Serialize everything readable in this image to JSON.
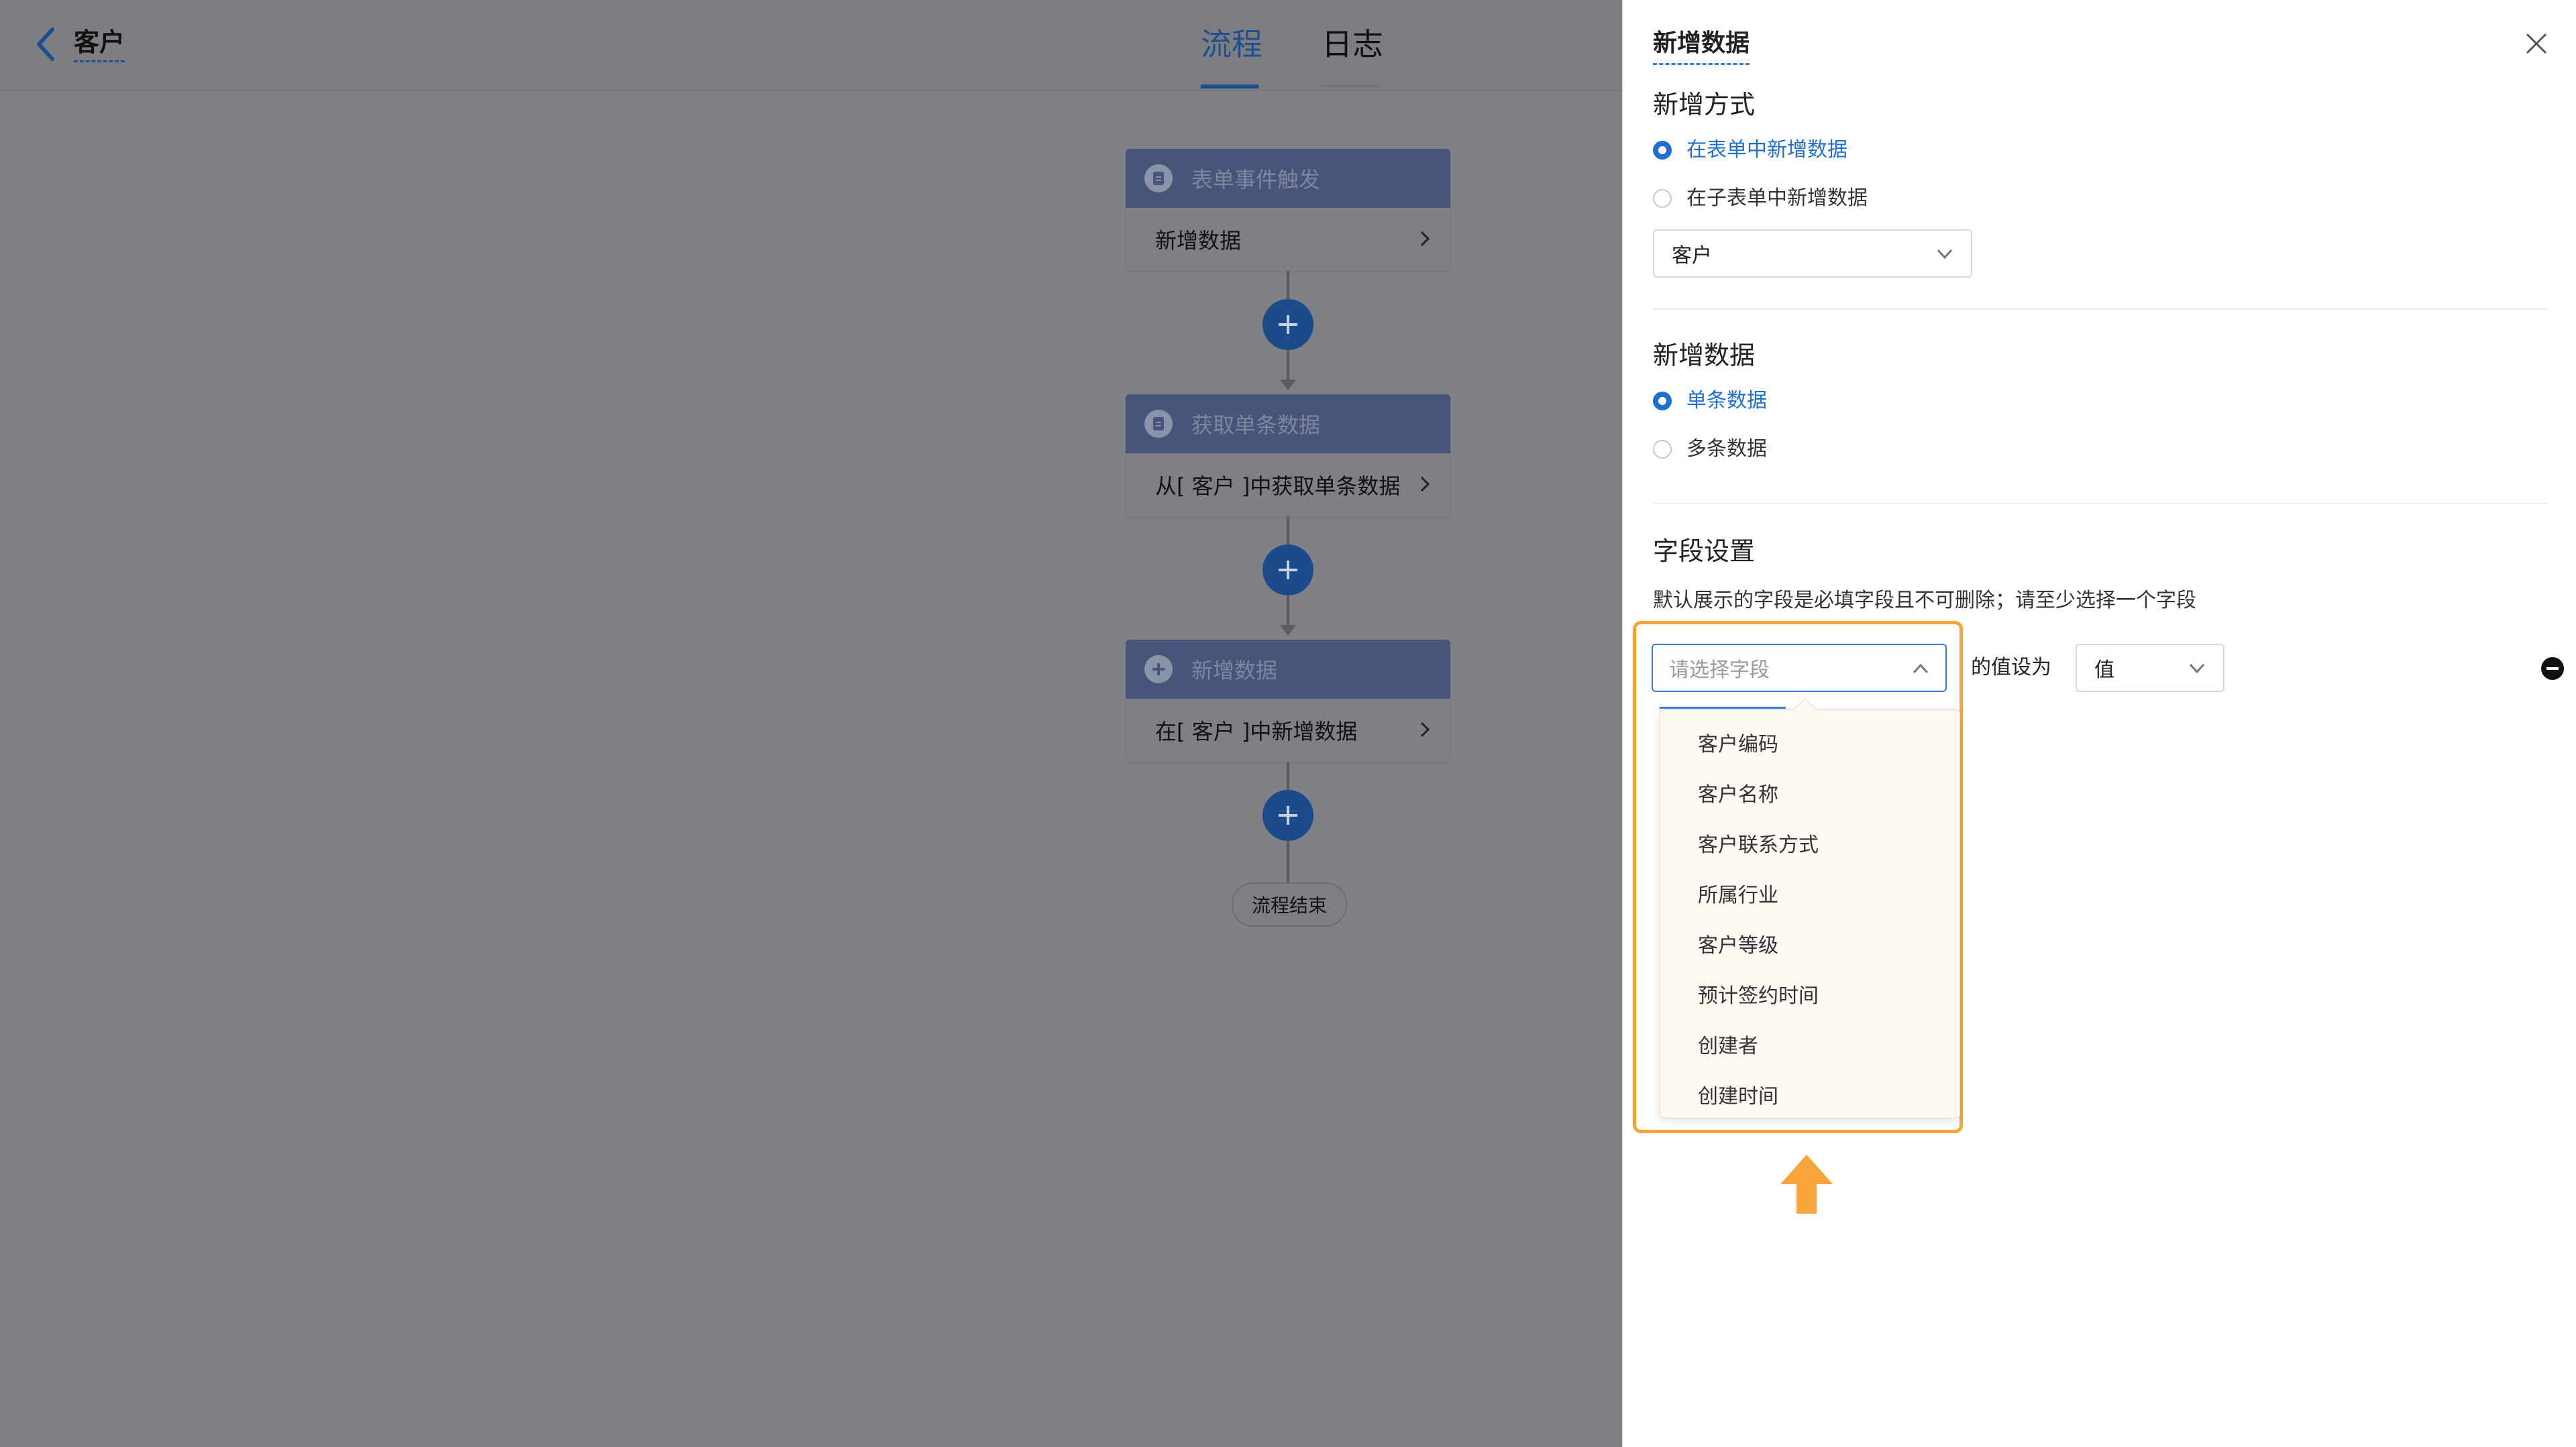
{
  "header": {
    "back_label": "客户",
    "tabs": [
      {
        "label": "流程",
        "active": true
      },
      {
        "label": "日志",
        "active": false
      }
    ]
  },
  "flow": {
    "nodes": [
      {
        "title": "表单事件触发",
        "body": "新增数据",
        "icon": "document-icon"
      },
      {
        "title": "获取单条数据",
        "body": "从[ 客户 ]中获取单条数据",
        "icon": "document-icon"
      },
      {
        "title": "新增数据",
        "body": "在[ 客户 ]中新增数据",
        "icon": "plus-circle-icon"
      }
    ],
    "end_label": "流程结束"
  },
  "panel": {
    "title": "新增数据",
    "mode_section": {
      "label": "新增方式",
      "options": [
        {
          "label": "在表单中新增数据",
          "selected": true
        },
        {
          "label": "在子表单中新增数据",
          "selected": false
        }
      ],
      "form_select_value": "客户"
    },
    "data_section": {
      "label": "新增数据",
      "options": [
        {
          "label": "单条数据",
          "selected": true
        },
        {
          "label": "多条数据",
          "selected": false
        }
      ]
    },
    "field_section": {
      "label": "字段设置",
      "hint": "默认展示的字段是必填字段且不可删除；请至少选择一个字段",
      "field_placeholder": "请选择字段",
      "set_value_label": "的值设为",
      "value_select": "值",
      "dropdown_options": [
        "客户编码",
        "客户名称",
        "客户联系方式",
        "所属行业",
        "客户等级",
        "预计签约时间",
        "创建者",
        "创建时间"
      ]
    }
  },
  "colors": {
    "accent": "#1f6fd1",
    "highlight": "#f7a53a",
    "node_header": "#465579",
    "plus_button": "#1b4b8a"
  }
}
